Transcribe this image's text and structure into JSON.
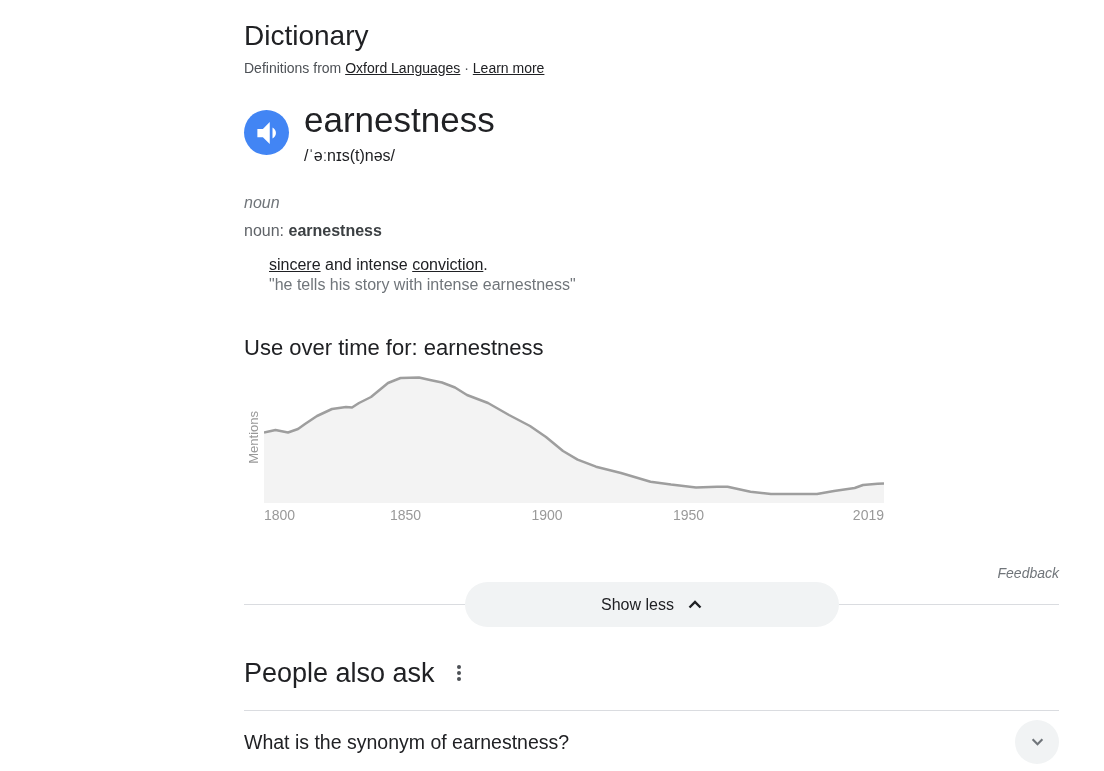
{
  "header": {
    "title": "Dictionary",
    "source": [
      {
        "kind": "text",
        "text": "Definitions from "
      },
      {
        "kind": "link",
        "text": "Oxford Languages"
      },
      {
        "kind": "text",
        "text": " · "
      },
      {
        "kind": "link",
        "text": "Learn more"
      }
    ]
  },
  "entry": {
    "word": "earnestness",
    "phonetic": "/ˈəːnɪs(t)nəs/",
    "part_of_speech": "noun",
    "forms": "noun: **earnestness**",
    "senses": [
      {
        "definition": [
          {
            "kind": "link",
            "text": "sincere"
          },
          {
            "kind": "text",
            "text": " and intense "
          },
          {
            "kind": "link",
            "text": "conviction"
          },
          {
            "kind": "text",
            "text": "."
          }
        ],
        "example": "\"he tells his story with intense earnestness\""
      }
    ]
  },
  "usage": {
    "title": "Use over time for: earnestness",
    "ylabel": "Mentions",
    "x_labels": [
      "1800",
      "1850",
      "1900",
      "1950",
      "2019"
    ]
  },
  "feedback": "Feedback",
  "show_less": {
    "label": "Show less",
    "expanded": true
  },
  "people_also_ask": {
    "title": "People also ask",
    "questions": [
      {
        "text": "What is the synonym of earnestness?",
        "expanded": false
      }
    ]
  }
}
